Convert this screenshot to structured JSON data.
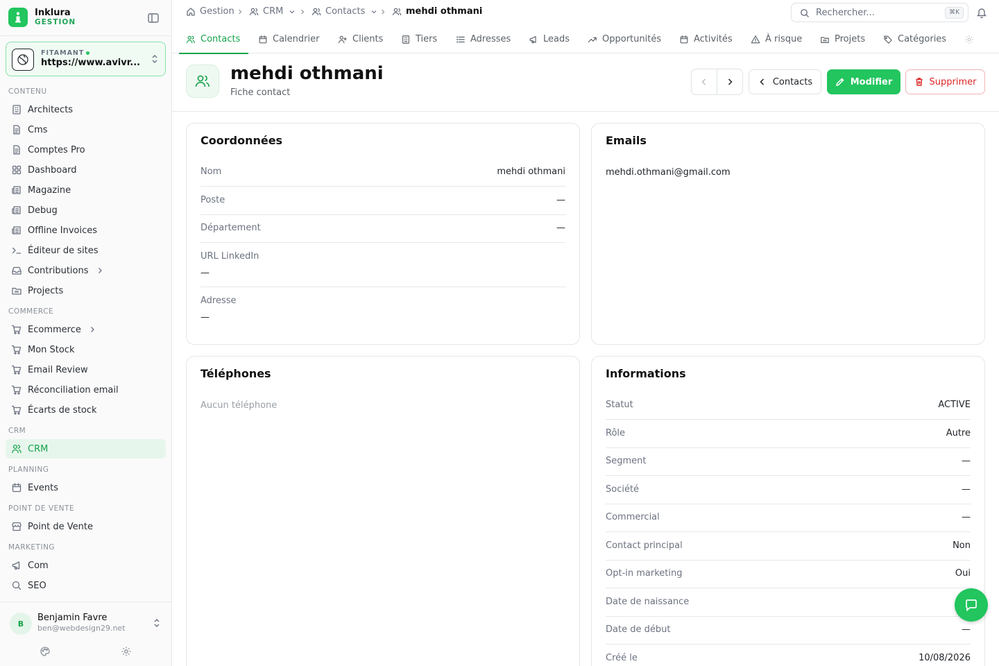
{
  "colors": {
    "accent": "#22c55e",
    "accent_text": "#16a34a",
    "danger": "#dc2626"
  },
  "brand": {
    "name": "Inklura",
    "sub": "GESTION"
  },
  "site_switcher": {
    "label": "FITAMANT",
    "url": "https://www.avivr..."
  },
  "sidebar": {
    "sections": [
      {
        "label": "CONTENU",
        "items": [
          {
            "label": "Architects",
            "icon": "building-icon"
          },
          {
            "label": "Cms",
            "icon": "file-icon"
          },
          {
            "label": "Comptes Pro",
            "icon": "file-icon"
          },
          {
            "label": "Dashboard",
            "icon": "grid-icon"
          },
          {
            "label": "Magazine",
            "icon": "newspaper-icon"
          },
          {
            "label": "Debug",
            "icon": "newspaper-icon"
          },
          {
            "label": "Offline Invoices",
            "icon": "newspaper-icon"
          },
          {
            "label": "Éditeur de sites",
            "icon": "terminal-icon"
          },
          {
            "label": "Contributions",
            "icon": "inbox-icon",
            "has_children": true
          },
          {
            "label": "Projects",
            "icon": "folder-icon"
          }
        ]
      },
      {
        "label": "COMMERCE",
        "items": [
          {
            "label": "Ecommerce",
            "icon": "cart-icon",
            "has_children": true
          },
          {
            "label": "Mon Stock",
            "icon": "cart-icon"
          },
          {
            "label": "Email Review",
            "icon": "cart-icon"
          },
          {
            "label": "Réconciliation email",
            "icon": "cart-icon"
          },
          {
            "label": "Écarts de stock",
            "icon": "cart-icon"
          }
        ]
      },
      {
        "label": "CRM",
        "items": [
          {
            "label": "CRM",
            "icon": "users-icon",
            "active": true
          }
        ]
      },
      {
        "label": "PLANNING",
        "items": [
          {
            "label": "Events",
            "icon": "calendar-icon"
          }
        ]
      },
      {
        "label": "POINT DE VENTE",
        "items": [
          {
            "label": "Point de Vente",
            "icon": "store-icon"
          }
        ]
      },
      {
        "label": "MARKETING",
        "items": [
          {
            "label": "Com",
            "icon": "megaphone-icon"
          },
          {
            "label": "SEO",
            "icon": "search-icon"
          }
        ]
      }
    ]
  },
  "user": {
    "initial": "B",
    "name": "Benjamin Favre",
    "email": "ben@webdesign29.net"
  },
  "breadcrumb": {
    "home": "Gestion",
    "crm": "CRM",
    "contacts": "Contacts",
    "current": "mehdi othmani"
  },
  "search": {
    "placeholder": "Rechercher...",
    "shortcut": "⌘K"
  },
  "tabs": [
    {
      "label": "Contacts",
      "icon": "users-icon",
      "active": true
    },
    {
      "label": "Calendrier",
      "icon": "calendar-icon"
    },
    {
      "label": "Clients",
      "icon": "user-plus-icon"
    },
    {
      "label": "Tiers",
      "icon": "building-icon"
    },
    {
      "label": "Adresses",
      "icon": "list-icon"
    },
    {
      "label": "Leads",
      "icon": "megaphone-icon"
    },
    {
      "label": "Opportunités",
      "icon": "trending-icon"
    },
    {
      "label": "Activités",
      "icon": "calendar-icon"
    },
    {
      "label": "À risque",
      "icon": "warning-icon"
    },
    {
      "label": "Projets",
      "icon": "folder-icon"
    },
    {
      "label": "Catégories",
      "icon": "tag-icon"
    }
  ],
  "page": {
    "title": "mehdi othmani",
    "subtitle": "Fiche contact",
    "back_label": "Contacts",
    "edit_label": "Modifier",
    "delete_label": "Supprimer"
  },
  "coordonnees": {
    "title": "Coordonnées",
    "rows": [
      {
        "label": "Nom",
        "value": "mehdi othmani"
      },
      {
        "label": "Poste",
        "value": "—"
      },
      {
        "label": "Département",
        "value": "—"
      }
    ],
    "stacked": [
      {
        "label": "URL LinkedIn",
        "value": "—"
      },
      {
        "label": "Adresse",
        "value": "—"
      }
    ]
  },
  "emails": {
    "title": "Emails",
    "value": "mehdi.othmani@gmail.com"
  },
  "telephones": {
    "title": "Téléphones",
    "empty": "Aucun téléphone"
  },
  "informations": {
    "title": "Informations",
    "rows": [
      {
        "label": "Statut",
        "value": "ACTIVE"
      },
      {
        "label": "Rôle",
        "value": "Autre"
      },
      {
        "label": "Segment",
        "value": "—"
      },
      {
        "label": "Société",
        "value": "—"
      },
      {
        "label": "Commercial",
        "value": "—"
      },
      {
        "label": "Contact principal",
        "value": "Non"
      },
      {
        "label": "Opt-in marketing",
        "value": "Oui"
      },
      {
        "label": "Date de naissance",
        "value": ""
      },
      {
        "label": "Date de début",
        "value": "—"
      },
      {
        "label": "Créé le",
        "value": "10/08/2026"
      }
    ]
  }
}
